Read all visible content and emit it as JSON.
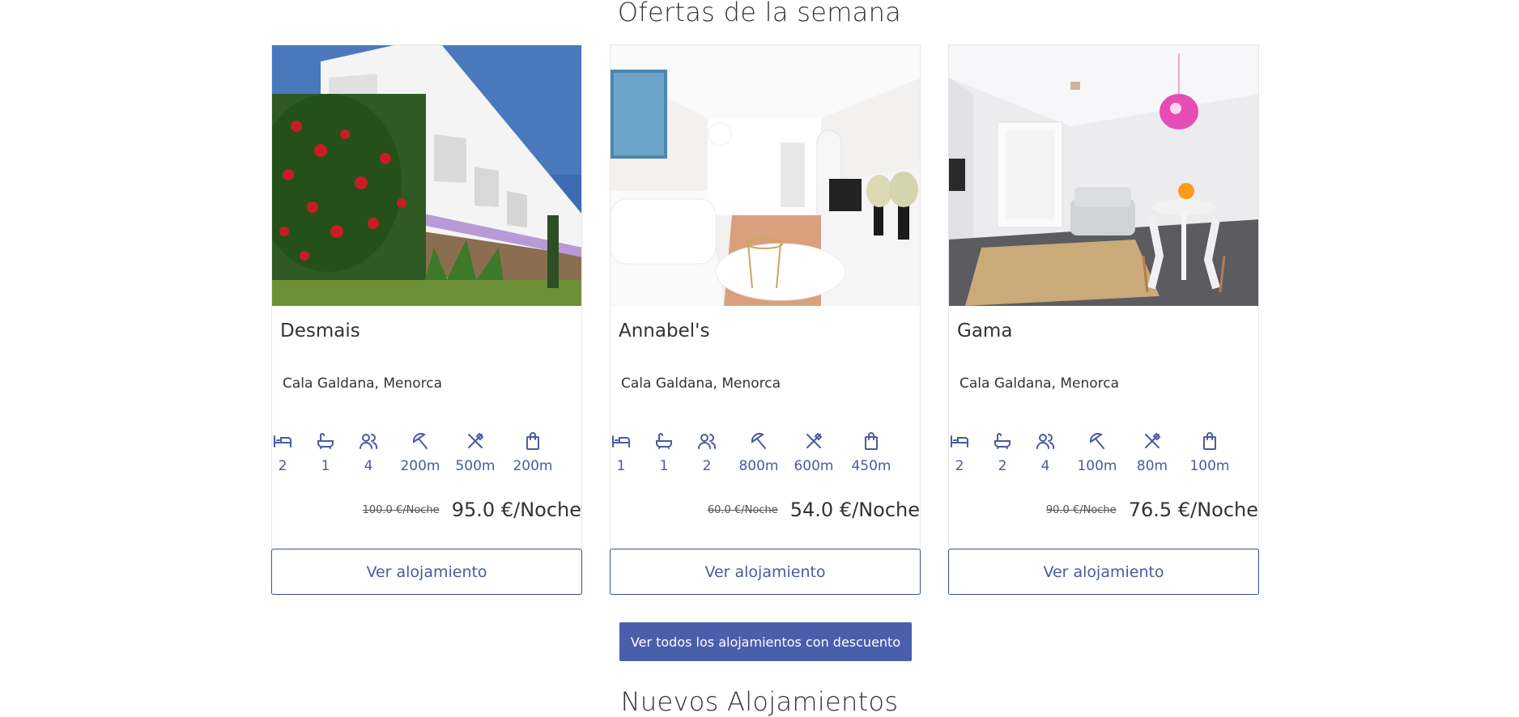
{
  "sections": {
    "offers_title": "Ofertas de la semana",
    "new_title": "Nuevos Alojamientos"
  },
  "colors": {
    "accent": "#4a5fab",
    "icon": "#4a5b9e",
    "text": "#333333"
  },
  "feature_icons": [
    "bed-icon",
    "bath-icon",
    "guests-icon",
    "beach-icon",
    "restaurant-icon",
    "shop-icon"
  ],
  "cards": [
    {
      "name": "Desmais",
      "location": "Cala Galdana, Menorca",
      "features": [
        "2",
        "1",
        "4",
        "200m",
        "500m",
        "200m"
      ],
      "old_price": "100.0 €/Noche",
      "price": "95.0 €/Noche",
      "button": "Ver alojamiento"
    },
    {
      "name": "Annabel's",
      "location": "Cala Galdana, Menorca",
      "features": [
        "1",
        "1",
        "2",
        "800m",
        "600m",
        "450m"
      ],
      "old_price": "60.0 €/Noche",
      "price": "54.0 €/Noche",
      "button": "Ver alojamiento"
    },
    {
      "name": "Gama",
      "location": "Cala Galdana, Menorca",
      "features": [
        "2",
        "2",
        "4",
        "100m",
        "80m",
        "100m"
      ],
      "old_price": "90.0 €/Noche",
      "price": "76.5 €/Noche",
      "button": "Ver alojamiento"
    }
  ],
  "all_discounts_button": "Ver todos los alojamientos con descuento"
}
